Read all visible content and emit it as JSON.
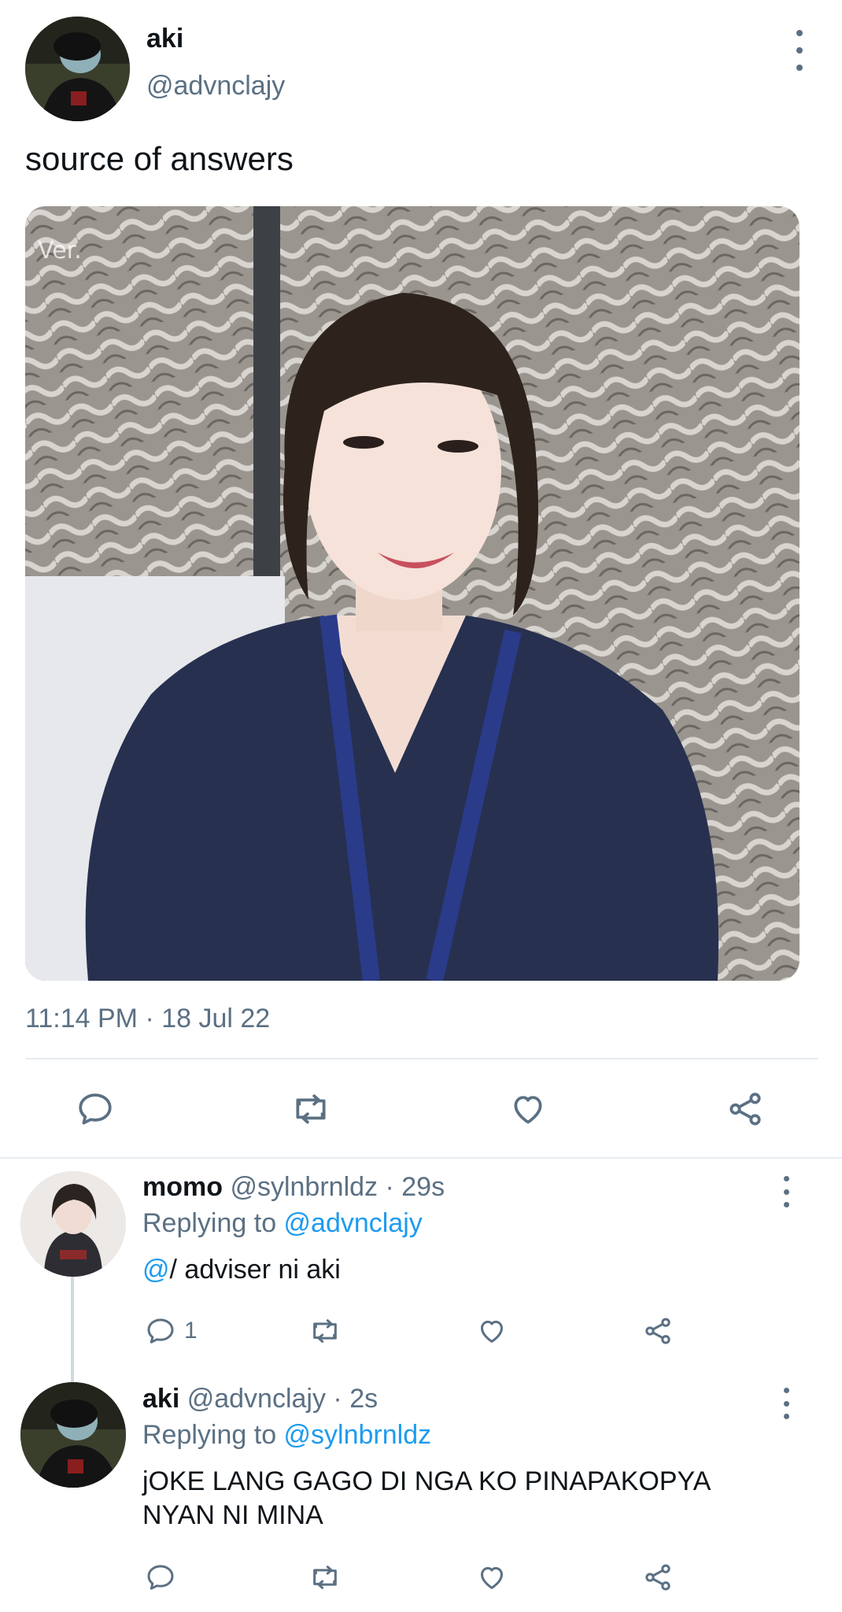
{
  "main_tweet": {
    "author_name": "aki",
    "handle": "@advnclajy",
    "text": "source of answers",
    "media_watermark": "Ver.",
    "timestamp": "11:14 PM · 18 Jul 22"
  },
  "actions": {
    "reply_icon": "reply-icon",
    "retweet_icon": "retweet-icon",
    "like_icon": "heart-icon",
    "share_icon": "share-icon"
  },
  "replies": [
    {
      "author_name": "momo",
      "handle_time": "@sylnbrnldz · 29s",
      "replying_label": "Replying to ",
      "replying_handle": "@advnclajy",
      "text_mention": "@",
      "text": "/ adviser ni aki",
      "reply_count": "1"
    },
    {
      "author_name": "aki",
      "handle_time": "@advnclajy · 2s",
      "replying_label": "Replying to ",
      "replying_handle": "@sylnbrnldz",
      "text_line1": "jOKE LANG GAGO DI NGA KO PINAPAKOPYA",
      "text_line2": "NYAN NI MINA"
    }
  ],
  "colors": {
    "accent_blue": "#1d9bf0",
    "secondary_text": "#5b7083",
    "divider": "#e6ecf0"
  }
}
